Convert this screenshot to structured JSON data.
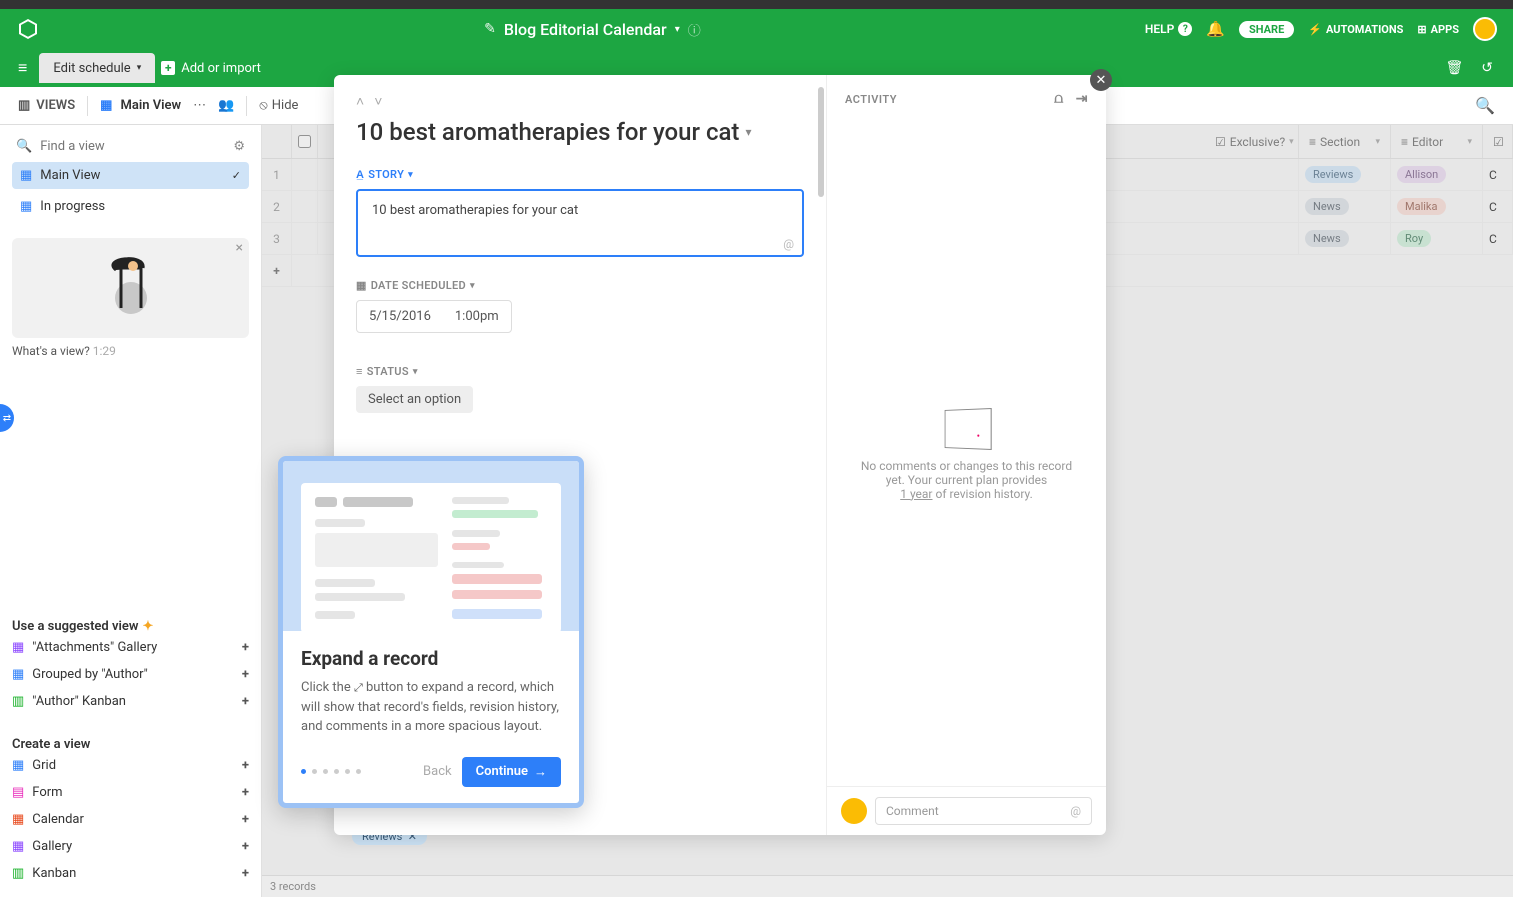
{
  "topbar": {
    "title": "Blog Editorial Calendar",
    "help": "HELP",
    "share": "SHARE",
    "automations": "AUTOMATIONS",
    "apps": "APPS"
  },
  "tabs": {
    "active": "Edit schedule",
    "add_or_import": "Add or import"
  },
  "viewbar": {
    "views": "VIEWS",
    "main_view": "Main View",
    "hide": "Hide"
  },
  "sidebar": {
    "find_placeholder": "Find a view",
    "views": [
      {
        "label": "Main View",
        "active": true
      },
      {
        "label": "In progress",
        "active": false
      }
    ],
    "promo_caption": "What's a view?",
    "promo_time": "1:29",
    "suggested_header": "Use a suggested view",
    "suggested": [
      {
        "label": "\"Attachments\" Gallery",
        "color": "purple"
      },
      {
        "label": "Grouped by \"Author\"",
        "color": "blue"
      },
      {
        "label": "\"Author\" Kanban",
        "color": "green"
      }
    ],
    "create_header": "Create a view",
    "create": [
      {
        "label": "Grid",
        "color": "blue"
      },
      {
        "label": "Form",
        "color": "pink"
      },
      {
        "label": "Calendar",
        "color": "red"
      },
      {
        "label": "Gallery",
        "color": "purple"
      },
      {
        "label": "Kanban",
        "color": "green"
      }
    ]
  },
  "grid": {
    "columns": {
      "exclusive": "Exclusive?",
      "section": "Section",
      "editor": "Editor"
    },
    "rows": [
      {
        "n": "1",
        "section": "Reviews",
        "section_class": "pill-blue",
        "editor": "Allison",
        "editor_class": "pill-lav"
      },
      {
        "n": "2",
        "section": "News",
        "section_class": "pill-grey",
        "editor": "Malika",
        "editor_class": "pill-peach"
      },
      {
        "n": "3",
        "section": "News",
        "section_class": "pill-grey",
        "editor": "Roy",
        "editor_class": "pill-mint"
      }
    ],
    "footer": "3 records"
  },
  "record": {
    "title": "10 best aromatherapies for your cat",
    "fields": {
      "story_label": "STORY",
      "story_value": "10 best aromatherapies for your cat",
      "date_label": "DATE SCHEDULED",
      "date_value": "5/15/2016",
      "time_value": "1:00pm",
      "status_label": "STATUS",
      "status_placeholder": "Select an option"
    },
    "activity_label": "ACTIVITY",
    "activity_empty_line1": "No comments or changes to this record yet. Your current plan provides",
    "activity_empty_line2": "1 year",
    "activity_empty_line3": " of revision history.",
    "comment_placeholder": "Comment"
  },
  "tour": {
    "title": "Expand a record",
    "body_pre": "Click the ",
    "body_post": " button to expand a record, which will show that record's fields, revision history, and comments in a more spacious layout.",
    "back": "Back",
    "continue": "Continue"
  },
  "peek": {
    "select": "Select an option",
    "reviews": "Reviews"
  }
}
